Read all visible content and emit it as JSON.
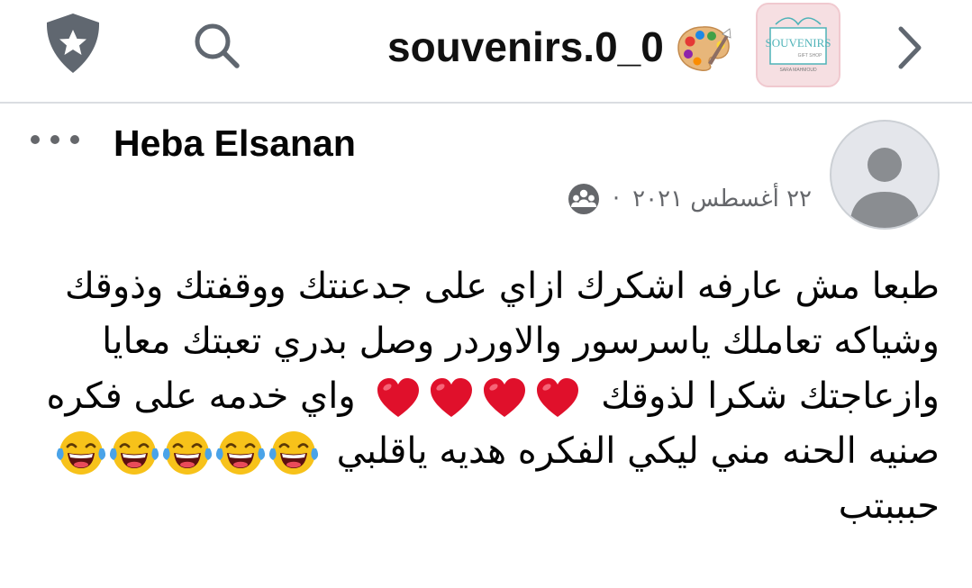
{
  "header": {
    "page_name": "souvenirs.0_0",
    "page_avatar_text": {
      "brand": "SOUVENIRS",
      "sub": "GIFT SHOP",
      "owner": "SARA MAHMOUD"
    }
  },
  "post": {
    "author": "Heba Elsanan",
    "date": "٢٢ أغسطس ٢٠٢١",
    "separator": "·",
    "lines": [
      "طبعا مش عارفه اشكرك ازاي على جدعنتك ووقفتك وذوقك",
      "وشياكه تعاملك ياسرسور والاوردر وصل بدري تعبتك معايا",
      {
        "before": "وازعاجتك شكرا لذوقك",
        "hearts": 4,
        "after": "واي خدمه على فكره"
      },
      {
        "before": "صنيه الحنه مني ليكي الفكره هديه ياقلبي",
        "laughs": 5
      },
      "حبببتب"
    ]
  },
  "colors": {
    "icon_gray": "#606770",
    "divider": "#dadde1",
    "heart_red": "#e0102b",
    "emoji_yellow": "#f7c21a"
  },
  "icons": [
    "shield-star-icon",
    "search-icon",
    "artist-palette-emoji",
    "chevron-right-icon",
    "more-dots-icon",
    "default-avatar-icon",
    "group-audience-icon",
    "red-heart-emoji",
    "tears-of-joy-emoji"
  ]
}
